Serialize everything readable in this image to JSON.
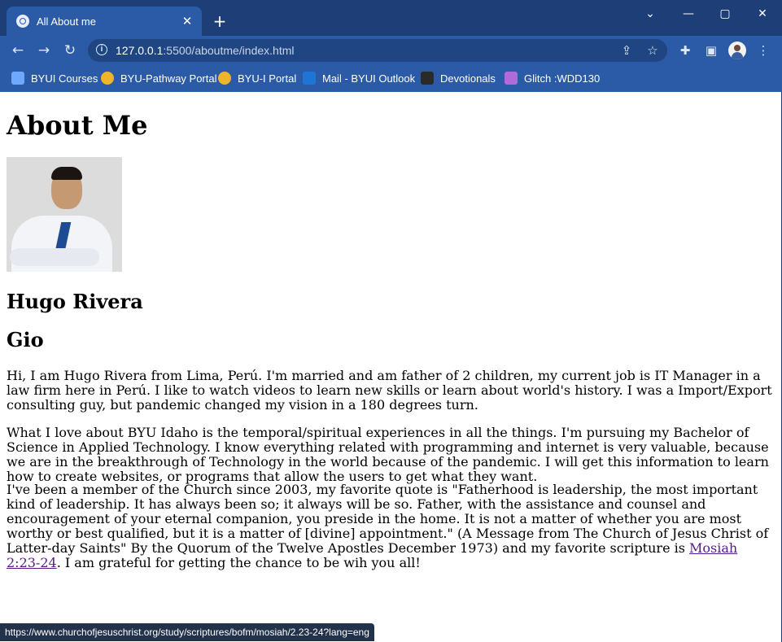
{
  "browser": {
    "tab_title": "All About me",
    "tab_close": "✕",
    "new_tab": "+",
    "url_host": "127.0.0.1",
    "url_rest": ":5500/aboutme/index.html",
    "window_controls": [
      "⌄",
      "—",
      "▢",
      "✕"
    ]
  },
  "bookmarks": [
    {
      "label": "BYUI Courses",
      "icon": "bar-chart-icon",
      "color": "#6fa8ff"
    },
    {
      "label": "BYU-Pathway Portal",
      "icon": "pathway-logo-icon",
      "color": "#f0b42a"
    },
    {
      "label": "BYU-I Portal",
      "icon": "pathway-logo-icon",
      "color": "#f0b42a"
    },
    {
      "label": "Mail - BYUI Outlook",
      "icon": "outlook-icon",
      "color": "#1f75d6"
    },
    {
      "label": "Devotionals",
      "icon": "byui-devotionals-icon",
      "color": "#2a2a2a"
    },
    {
      "label": "Glitch :WDD130",
      "icon": "glitch-icon",
      "color": "#b06ad9"
    }
  ],
  "page": {
    "heading": "About Me",
    "name": "Hugo Rivera",
    "nickname": "Gio",
    "para1": "Hi, I am Hugo Rivera from Lima, Perú. I'm married and am father of 2 children, my current job is IT Manager in a law firm here in Perú. I like to watch videos to learn new skills or learn about world's history. I was a Import/Export consulting guy, but pandemic changed my vision in a 180 degrees turn.",
    "para2": "What I love about BYU Idaho is the temporal/spiritual experiences in all the things. I'm pursuing my Bachelor of Science in Applied Technology. I know everything related with programming and internet is very valuable, because we are in the breakthrough of Technology in the world because of the pandemic. I will get this information to learn how to create websites, or programs that allow the users to get what they want.",
    "para3_before": "I've been a member of the Church since 2003, my favorite quote is \"Fatherhood is leadership, the most important kind of leadership. It has always been so; it always will be so. Father, with the assistance and counsel and encouragement of your eternal companion, you preside in the home. It is not a matter of whether you are most worthy or best qualified, but it is a matter of [divine] appointment.\" (A Message from The Church of Jesus Christ of Latter-day Saints\" By the Quorum of the Twelve Apostles December 1973) and my favorite scripture is ",
    "scripture_link": "Mosiah 2:23-24",
    "para3_after": ". I am grateful for getting the chance to be wih you all!"
  },
  "status_url": "https://www.churchofjesuschrist.org/study/scriptures/bofm/mosiah/2.23-24?lang=eng"
}
